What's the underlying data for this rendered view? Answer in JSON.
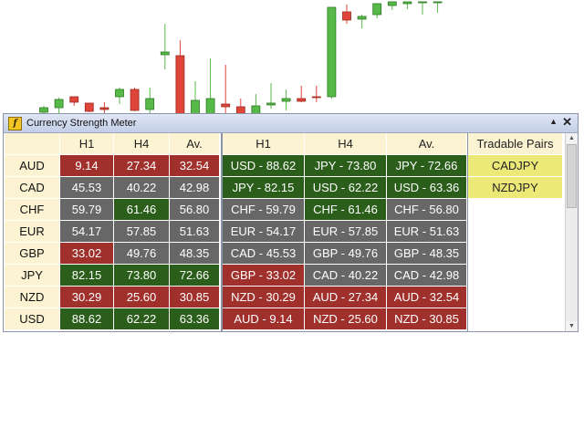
{
  "window": {
    "title": "Currency Strength Meter",
    "icon_glyph": "f",
    "collapse_glyph": "▲",
    "close_glyph": "✕"
  },
  "strength_table": {
    "headers": [
      "",
      "H1",
      "H4",
      "Av."
    ],
    "rows": [
      {
        "currency": "AUD",
        "cells": [
          {
            "v": "9.14",
            "c": "red"
          },
          {
            "v": "27.34",
            "c": "red"
          },
          {
            "v": "32.54",
            "c": "red"
          }
        ]
      },
      {
        "currency": "CAD",
        "cells": [
          {
            "v": "45.53",
            "c": "gry"
          },
          {
            "v": "40.22",
            "c": "gry"
          },
          {
            "v": "42.98",
            "c": "gry"
          }
        ]
      },
      {
        "currency": "CHF",
        "cells": [
          {
            "v": "59.79",
            "c": "gry"
          },
          {
            "v": "61.46",
            "c": "grn"
          },
          {
            "v": "56.80",
            "c": "gry"
          }
        ]
      },
      {
        "currency": "EUR",
        "cells": [
          {
            "v": "54.17",
            "c": "gry"
          },
          {
            "v": "57.85",
            "c": "gry"
          },
          {
            "v": "51.63",
            "c": "gry"
          }
        ]
      },
      {
        "currency": "GBP",
        "cells": [
          {
            "v": "33.02",
            "c": "red"
          },
          {
            "v": "49.76",
            "c": "gry"
          },
          {
            "v": "48.35",
            "c": "gry"
          }
        ]
      },
      {
        "currency": "JPY",
        "cells": [
          {
            "v": "82.15",
            "c": "grn"
          },
          {
            "v": "73.80",
            "c": "grn"
          },
          {
            "v": "72.66",
            "c": "grn"
          }
        ]
      },
      {
        "currency": "NZD",
        "cells": [
          {
            "v": "30.29",
            "c": "red"
          },
          {
            "v": "25.60",
            "c": "red"
          },
          {
            "v": "30.85",
            "c": "red"
          }
        ]
      },
      {
        "currency": "USD",
        "cells": [
          {
            "v": "88.62",
            "c": "grn"
          },
          {
            "v": "62.22",
            "c": "grn"
          },
          {
            "v": "63.36",
            "c": "grn"
          }
        ]
      }
    ]
  },
  "ranking_table": {
    "headers": [
      "H1",
      "H4",
      "Av."
    ],
    "rows": [
      [
        {
          "v": "USD - 88.62",
          "c": "grn"
        },
        {
          "v": "JPY - 73.80",
          "c": "grn"
        },
        {
          "v": "JPY - 72.66",
          "c": "grn"
        }
      ],
      [
        {
          "v": "JPY - 82.15",
          "c": "grn"
        },
        {
          "v": "USD - 62.22",
          "c": "grn"
        },
        {
          "v": "USD - 63.36",
          "c": "grn"
        }
      ],
      [
        {
          "v": "CHF - 59.79",
          "c": "gry"
        },
        {
          "v": "CHF - 61.46",
          "c": "grn"
        },
        {
          "v": "CHF - 56.80",
          "c": "gry"
        }
      ],
      [
        {
          "v": "EUR - 54.17",
          "c": "gry"
        },
        {
          "v": "EUR - 57.85",
          "c": "gry"
        },
        {
          "v": "EUR - 51.63",
          "c": "gry"
        }
      ],
      [
        {
          "v": "CAD - 45.53",
          "c": "gry"
        },
        {
          "v": "GBP - 49.76",
          "c": "gry"
        },
        {
          "v": "GBP - 48.35",
          "c": "gry"
        }
      ],
      [
        {
          "v": "GBP - 33.02",
          "c": "red"
        },
        {
          "v": "CAD - 40.22",
          "c": "gry"
        },
        {
          "v": "CAD - 42.98",
          "c": "gry"
        }
      ],
      [
        {
          "v": "NZD - 30.29",
          "c": "red"
        },
        {
          "v": "AUD - 27.34",
          "c": "red"
        },
        {
          "v": "AUD - 32.54",
          "c": "red"
        }
      ],
      [
        {
          "v": "AUD - 9.14",
          "c": "red"
        },
        {
          "v": "NZD - 25.60",
          "c": "red"
        },
        {
          "v": "NZD - 30.85",
          "c": "red"
        }
      ]
    ]
  },
  "tradable_pairs": {
    "header": "Tradable Pairs",
    "items": [
      "CADJPY",
      "NZDJPY"
    ]
  },
  "colors": {
    "strong": "#2a5e1a",
    "weak": "#a0302b",
    "neutral": "#666766",
    "highlight": "#ede979",
    "header": "#fbf3d1",
    "bull_candle": "#56b948",
    "bear_candle": "#e0453a"
  },
  "background_chart": {
    "type": "candlestick",
    "candles": [
      {
        "o": 3,
        "h": 10,
        "l": 0,
        "c": 8
      },
      {
        "o": 8,
        "h": 19,
        "l": 2,
        "c": 17
      },
      {
        "o": 20,
        "h": 20,
        "l": 10,
        "c": 14
      },
      {
        "o": 13,
        "h": 13,
        "l": 3,
        "c": 4
      },
      {
        "o": 8,
        "h": 14,
        "l": 0,
        "c": 6
      },
      {
        "o": 20,
        "h": 30,
        "l": 12,
        "c": 28
      },
      {
        "o": 28,
        "h": 30,
        "l": 4,
        "c": 5
      },
      {
        "o": 6,
        "h": 30,
        "l": 1,
        "c": 18
      },
      {
        "o": 66,
        "h": 100,
        "l": 50,
        "c": 69
      },
      {
        "o": 65,
        "h": 82,
        "l": 0,
        "c": 0
      },
      {
        "o": 0,
        "h": 37,
        "l": 0,
        "c": 16
      },
      {
        "o": 0,
        "h": 62,
        "l": 0,
        "c": 18
      },
      {
        "o": 12,
        "h": 55,
        "l": 2,
        "c": 9
      },
      {
        "o": 9,
        "h": 18,
        "l": 1,
        "c": 0
      },
      {
        "o": 0,
        "h": 23,
        "l": 0,
        "c": 10
      },
      {
        "o": 11,
        "h": 35,
        "l": 7,
        "c": 13
      },
      {
        "o": 15,
        "h": 28,
        "l": 5,
        "c": 18
      },
      {
        "o": 18,
        "h": 32,
        "l": 14,
        "c": 15
      },
      {
        "o": 20,
        "h": 32,
        "l": 14,
        "c": 19
      },
      {
        "o": 20,
        "h": 112,
        "l": 18,
        "c": 118
      },
      {
        "o": 113,
        "h": 121,
        "l": 100,
        "c": 104
      },
      {
        "o": 105,
        "h": 110,
        "l": 95,
        "c": 108
      },
      {
        "o": 110,
        "h": 122,
        "l": 106,
        "c": 122
      },
      {
        "o": 120,
        "h": 124,
        "l": 115,
        "c": 124
      },
      {
        "o": 122,
        "h": 124,
        "l": 116,
        "c": 124
      },
      {
        "o": 124,
        "h": 124,
        "l": 110,
        "c": 124
      },
      {
        "o": 124,
        "h": 124,
        "l": 112,
        "c": 124
      }
    ]
  }
}
